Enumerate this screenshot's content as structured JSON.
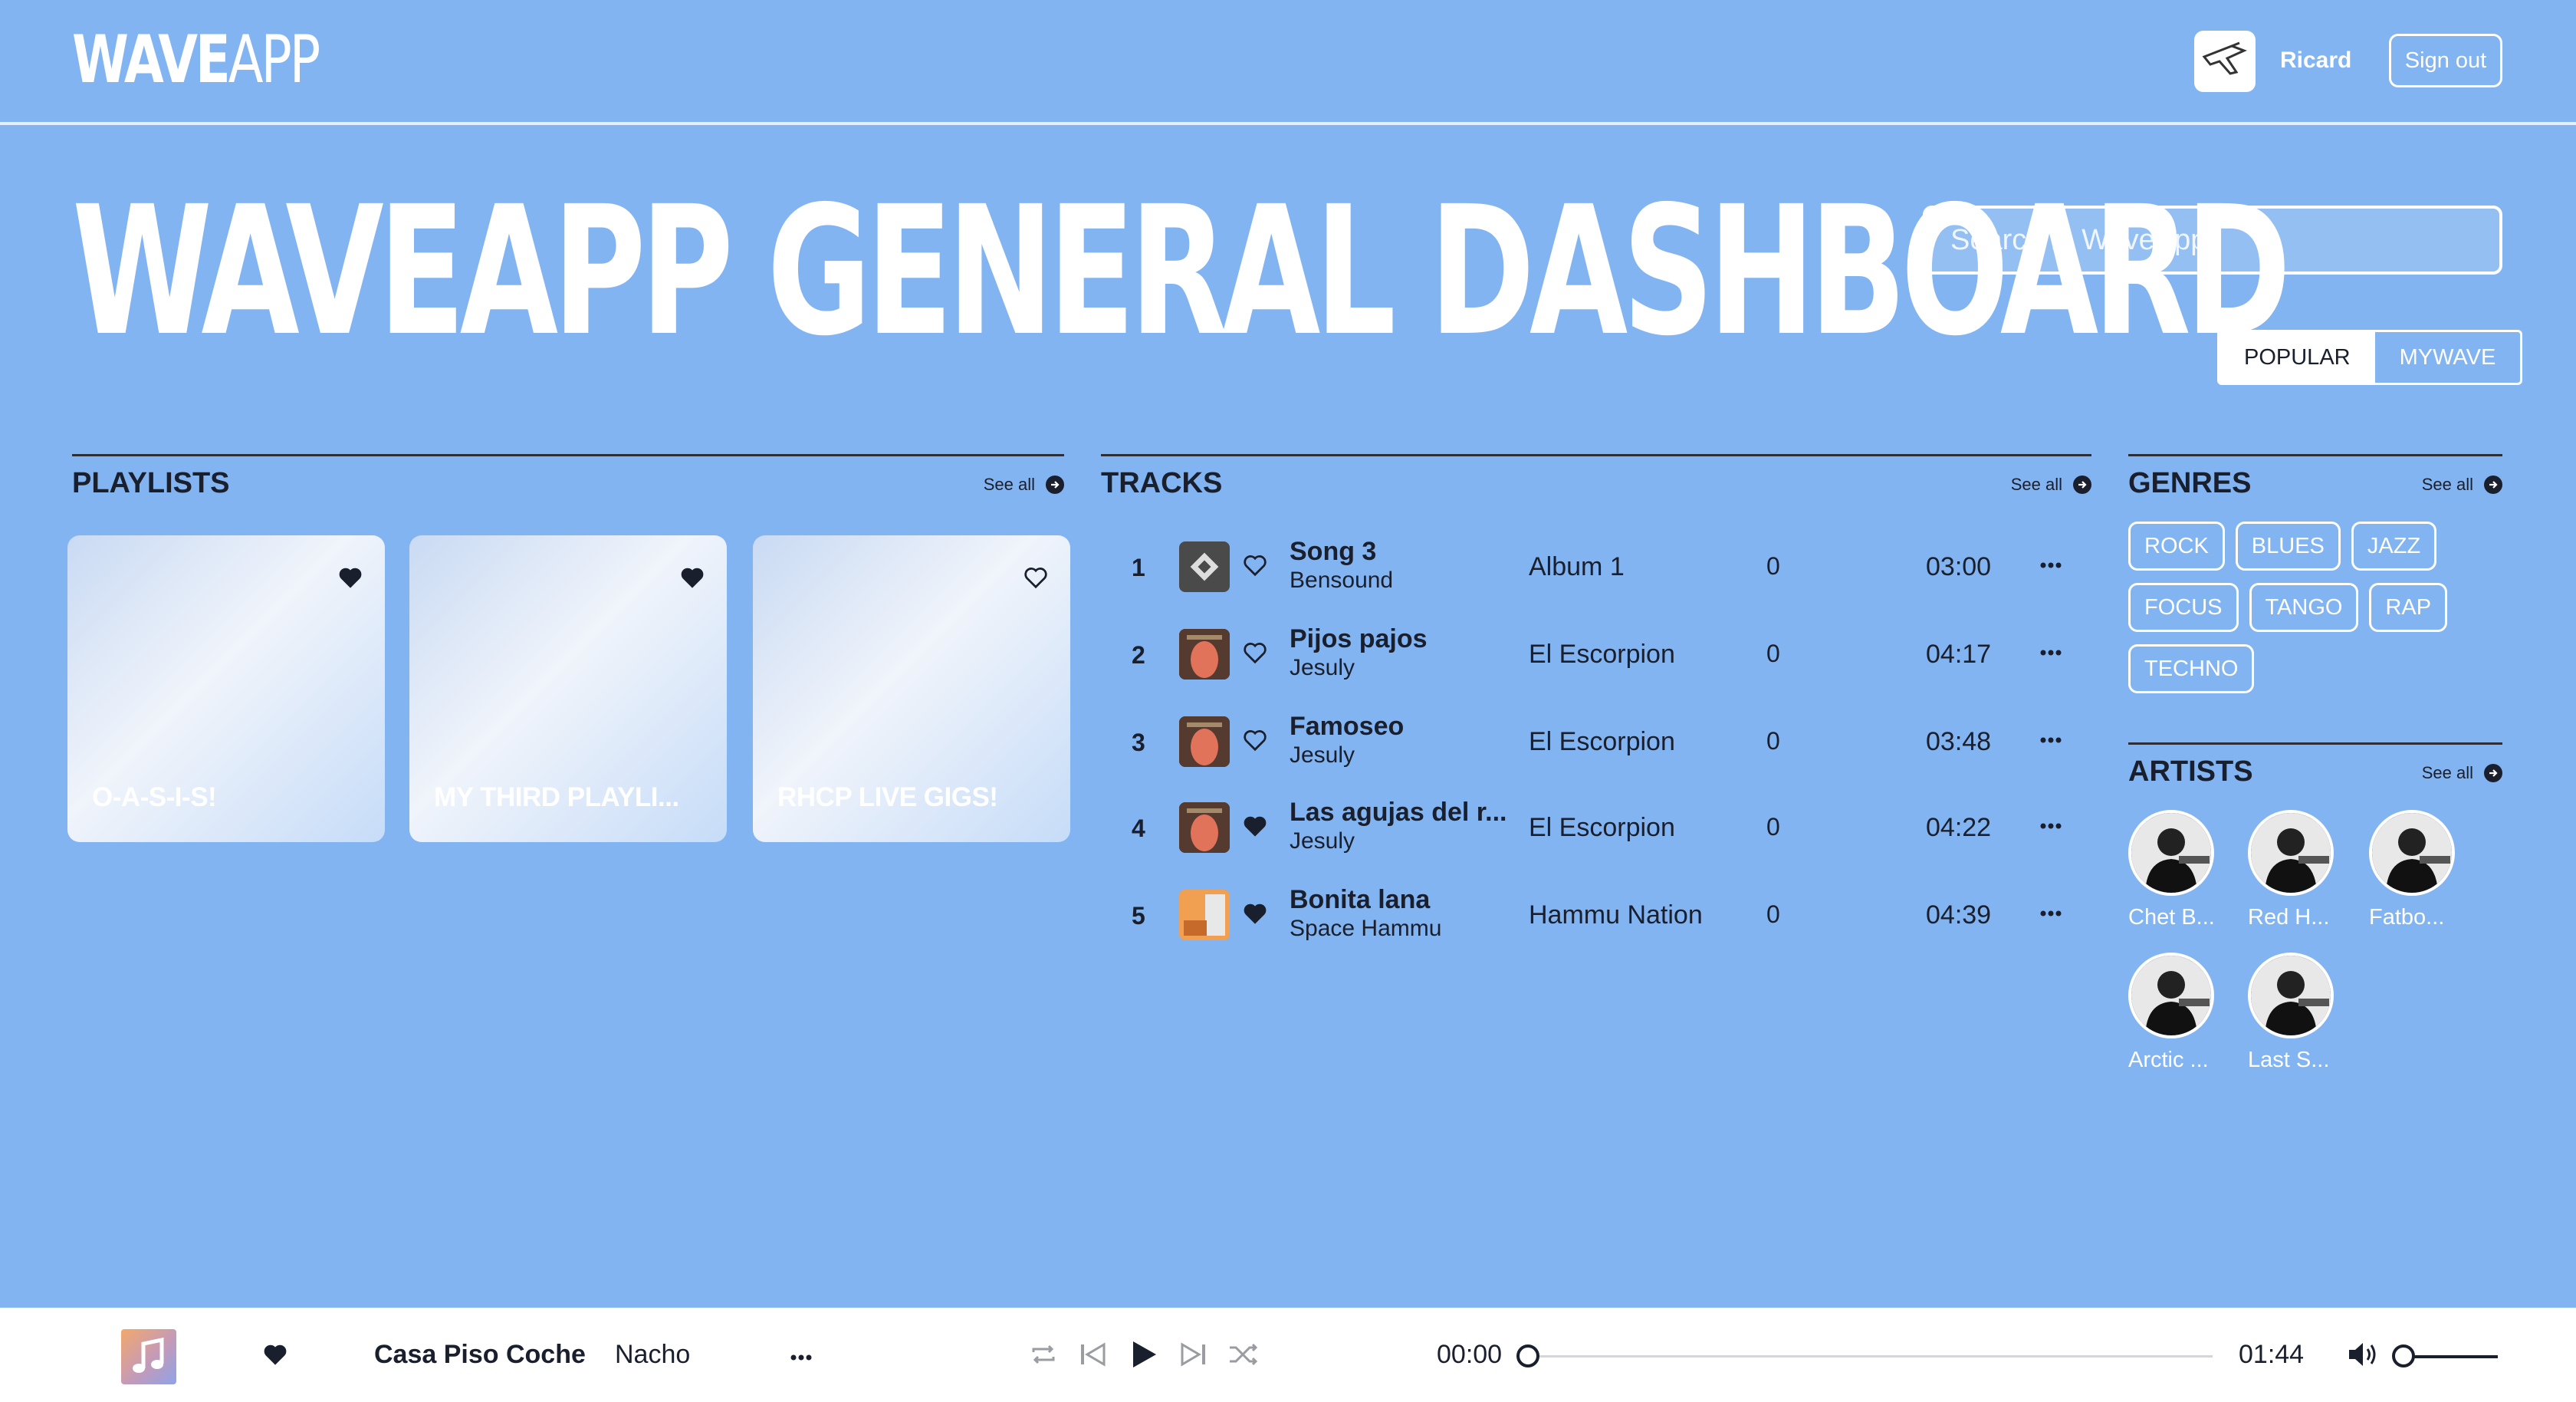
{
  "header": {
    "logo_bold": "WAVE",
    "logo_light": "APP",
    "user_name": "Ricard",
    "signout_label": "Sign out"
  },
  "page_title": "WAVEAPP GENERAL DASHBOARD",
  "search": {
    "placeholder": "Search in WaveApp"
  },
  "tabs": [
    {
      "label": "POPULAR",
      "active": true
    },
    {
      "label": "MYWAVE",
      "active": false
    }
  ],
  "playlists": {
    "title": "PLAYLISTS",
    "see_all": "See all",
    "items": [
      {
        "name": "O-A-S-I-S!",
        "favorited": true
      },
      {
        "name": "MY THIRD PLAYLI...",
        "favorited": true
      },
      {
        "name": "RHCP LIVE GIGS!",
        "favorited": false
      }
    ]
  },
  "tracks": {
    "title": "TRACKS",
    "see_all": "See all",
    "items": [
      {
        "num": "1",
        "title": "Song 3",
        "artist": "Bensound",
        "album": "Album 1",
        "plays": "0",
        "duration": "03:00",
        "favorited": false
      },
      {
        "num": "2",
        "title": "Pijos pajos",
        "artist": "Jesuly",
        "album": "El Escorpion",
        "plays": "0",
        "duration": "04:17",
        "favorited": false
      },
      {
        "num": "3",
        "title": "Famoseo",
        "artist": "Jesuly",
        "album": "El Escorpion",
        "plays": "0",
        "duration": "03:48",
        "favorited": false
      },
      {
        "num": "4",
        "title": "Las agujas del r...",
        "artist": "Jesuly",
        "album": "El Escorpion",
        "plays": "0",
        "duration": "04:22",
        "favorited": true
      },
      {
        "num": "5",
        "title": "Bonita lana",
        "artist": "Space Hammu",
        "album": "Hammu Nation",
        "plays": "0",
        "duration": "04:39",
        "favorited": true
      }
    ]
  },
  "genres": {
    "title": "GENRES",
    "see_all": "See all",
    "items": [
      "ROCK",
      "BLUES",
      "JAZZ",
      "FOCUS",
      "TANGO",
      "RAP",
      "TECHNO"
    ]
  },
  "artists": {
    "title": "ARTISTS",
    "see_all": "See all",
    "items": [
      "Chet B...",
      "Red H...",
      "Fatbo...",
      "Arctic ...",
      "Last S..."
    ]
  },
  "player": {
    "title": "Casa Piso Coche",
    "artist": "Nacho",
    "current_time": "00:00",
    "total_time": "01:44",
    "progress": 0,
    "volume": 0,
    "favorited": true
  },
  "colors": {
    "background": "#82b4f1",
    "text_dark": "#1a1f2e",
    "white": "#ffffff"
  }
}
